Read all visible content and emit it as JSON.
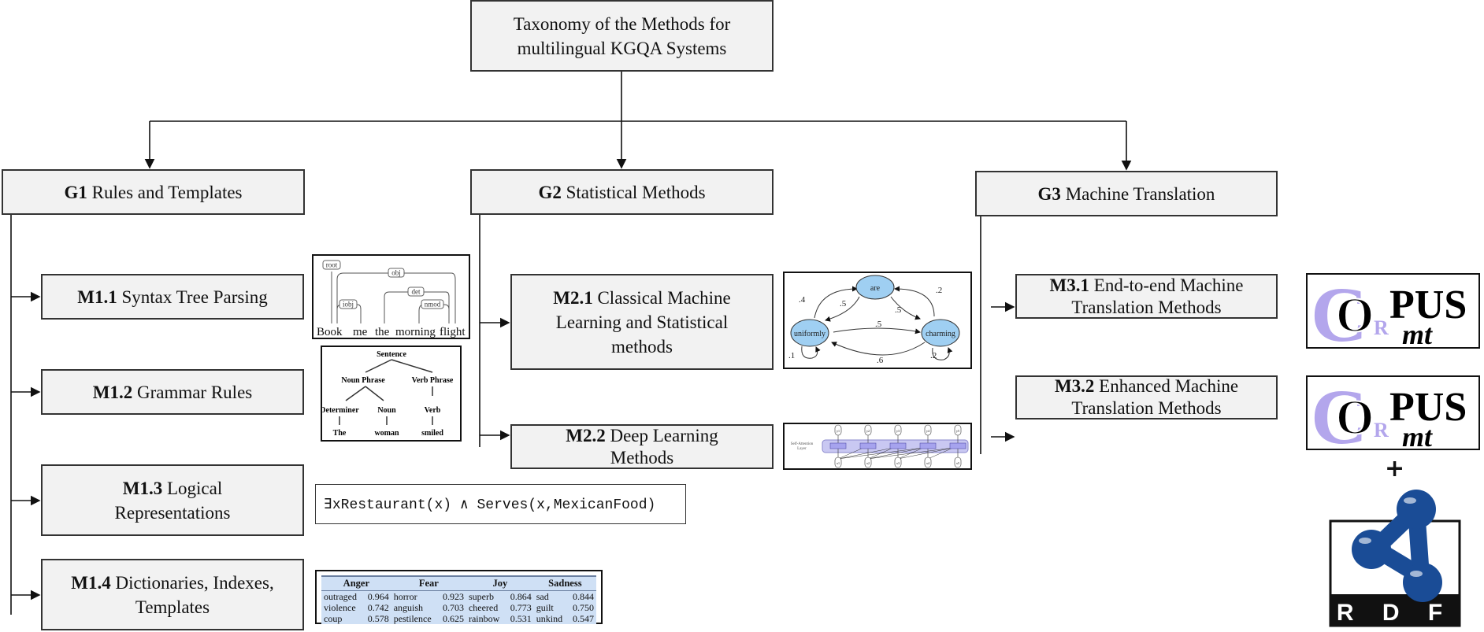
{
  "root": {
    "line1": "Taxonomy of the Methods for",
    "line2": "multilingual KGQA Systems"
  },
  "groups": [
    {
      "code": "G1",
      "label": "Rules and Templates"
    },
    {
      "code": "G2",
      "label": "Statistical Methods"
    },
    {
      "code": "G3",
      "label": "Machine Translation"
    }
  ],
  "methods": {
    "m11": {
      "code": "M1.1",
      "label": "Syntax Tree Parsing"
    },
    "m12": {
      "code": "M1.2",
      "label": "Grammar Rules"
    },
    "m13": {
      "code": "M1.3",
      "label1": "Logical",
      "label2": "Representations"
    },
    "m14": {
      "code": "M1.4",
      "label1": "Dictionaries, Indexes,",
      "label2": "Templates"
    },
    "m21": {
      "code": "M2.1",
      "label1": "Classical Machine",
      "label2": "Learning and Statistical",
      "label3": "methods"
    },
    "m22": {
      "code": "M2.2",
      "label1": "Deep Learning",
      "label2": "Methods"
    },
    "m31": {
      "code": "M3.1",
      "label1": "End-to-end Machine",
      "label2": "Translation Methods"
    },
    "m32": {
      "code": "M3.2",
      "label1": "Enhanced Machine",
      "label2": "Translation Methods"
    }
  },
  "dependency_tree": {
    "words": [
      "Book",
      "me",
      "the",
      "morning",
      "flight"
    ],
    "arcs": [
      "root",
      "obj",
      "iobj",
      "det",
      "nmod"
    ]
  },
  "grammar_tree": {
    "root": "Sentence",
    "np": "Noun Phrase",
    "vp": "Verb Phrase",
    "det": "Determiner",
    "noun": "Noun",
    "verb": "Verb",
    "w1": "The",
    "w2": "woman",
    "w3": "smiled"
  },
  "logic_formula": "∃xRestaurant(x) ∧ Serves(x,MexicanFood)",
  "emotion_table": {
    "headers": [
      "Anger",
      "Fear",
      "Joy",
      "Sadness"
    ],
    "rows": [
      [
        "outraged",
        "0.964",
        "horror",
        "0.923",
        "superb",
        "0.864",
        "sad",
        "0.844"
      ],
      [
        "violence",
        "0.742",
        "anguish",
        "0.703",
        "cheered",
        "0.773",
        "guilt",
        "0.750"
      ],
      [
        "coup",
        "0.578",
        "pestilence",
        "0.625",
        "rainbow",
        "0.531",
        "unkind",
        "0.547"
      ]
    ],
    "background": "#cfe0f5"
  },
  "markov_chain": {
    "nodes": [
      "are",
      "uniformly",
      "charming"
    ],
    "weights": [
      ".4",
      ".5",
      ".2",
      ".5",
      ".5",
      ".1",
      ".6",
      ".2"
    ],
    "node_color": "#9fcff2"
  },
  "attention": {
    "layer_label1": "Self-Attention",
    "layer_label2": "Layer",
    "outputs": [
      "y1",
      "y2",
      "y3",
      "y4",
      "y5"
    ],
    "inputs": [
      "x1",
      "x2",
      "x3",
      "x4",
      "x5"
    ],
    "layer_color": "#c9c8f2"
  },
  "logos": {
    "corpus": {
      "c": "C",
      "o": "O",
      "r": "R",
      "pus": "PUS",
      "mt": "mt",
      "accent": "#b3a6ec"
    },
    "plus": "+",
    "rdf": {
      "letters": "R D F",
      "color": "#1a4c96"
    }
  }
}
